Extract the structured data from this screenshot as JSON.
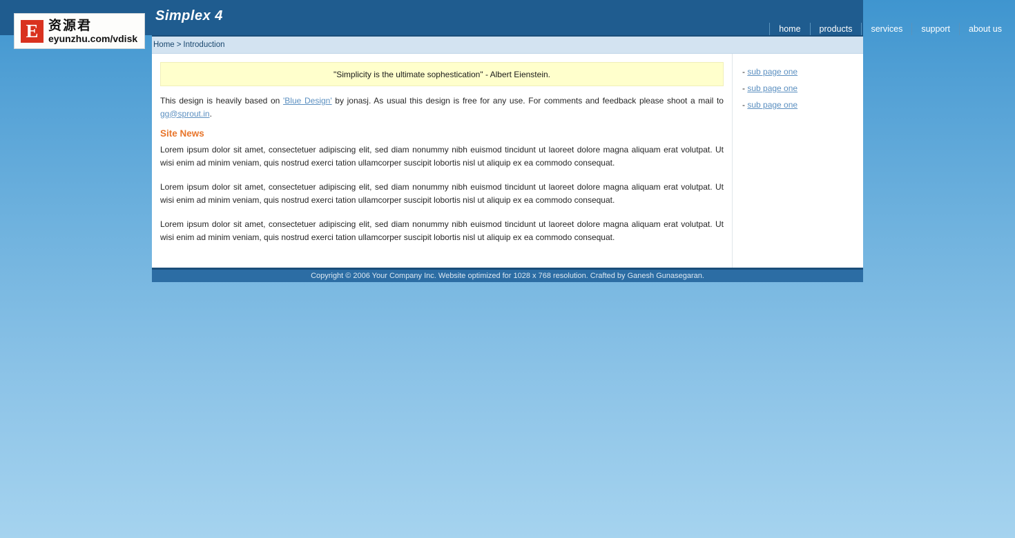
{
  "header": {
    "site_title": "Simplex 4",
    "logo": {
      "mark": "E",
      "chinese": "资源君",
      "url": "eyunzhu.com/vdisk"
    },
    "nav": [
      {
        "label": "home"
      },
      {
        "label": "products"
      },
      {
        "label": "services"
      },
      {
        "label": "support"
      },
      {
        "label": "about us"
      }
    ]
  },
  "breadcrumb": {
    "home": "Home",
    "separator": ">",
    "current": "Introduction"
  },
  "main": {
    "quote": "\"Simplicity is the ultimate sophestication\" - Albert Eienstein.",
    "intro": {
      "part1": "This design is heavily based on ",
      "link_design": "'Blue Design'",
      "part2": " by jonasj. As usual this design is free for any use. For comments and feedback please shoot a mail to ",
      "link_email": "gg@sprout.in",
      "part3": "."
    },
    "news_heading": "Site News",
    "paragraphs": [
      "Lorem ipsum dolor sit amet, consectetuer adipiscing elit, sed diam nonummy nibh euismod tincidunt ut laoreet dolore magna aliquam erat volutpat. Ut wisi enim ad minim veniam, quis nostrud exerci tation ullamcorper suscipit lobortis nisl ut aliquip ex ea commodo consequat.",
      "Lorem ipsum dolor sit amet, consectetuer adipiscing elit, sed diam nonummy nibh euismod tincidunt ut laoreet dolore magna aliquam erat volutpat. Ut wisi enim ad minim veniam, quis nostrud exerci tation ullamcorper suscipit lobortis nisl ut aliquip ex ea commodo consequat.",
      "Lorem ipsum dolor sit amet, consectetuer adipiscing elit, sed diam nonummy nibh euismod tincidunt ut laoreet dolore magna aliquam erat volutpat. Ut wisi enim ad minim veniam, quis nostrud exerci tation ullamcorper suscipit lobortis nisl ut aliquip ex ea commodo consequat."
    ]
  },
  "sidebar": {
    "bullet": "-",
    "items": [
      {
        "label": "sub page one"
      },
      {
        "label": "sub page one"
      },
      {
        "label": "sub page one"
      }
    ]
  },
  "footer": {
    "text": "Copyright © 2006 Your Company Inc. Website optimized for 1028 x 768 resolution. Crafted by Ganesh Gunasegaran."
  },
  "colors": {
    "header_blue": "#1f5c8f",
    "footer_blue": "#2c6da4",
    "accent_orange": "#e8762c",
    "link_blue": "#5b8fc0",
    "quote_yellow": "#ffffcc",
    "breadcrumb_blue": "#d3e3f1",
    "logo_red": "#d9321f"
  }
}
